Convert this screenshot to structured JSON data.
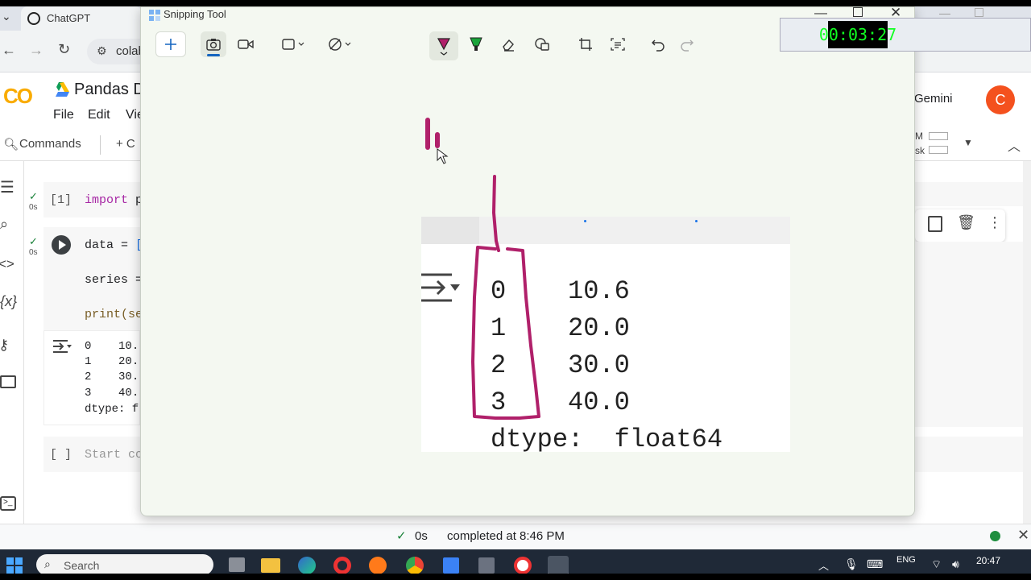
{
  "browser": {
    "tab_title": "ChatGPT",
    "url_partial": "colab"
  },
  "colab": {
    "logo": "CO",
    "title_partial": "Pandas D",
    "menu": [
      "File",
      "Edit",
      "Vie"
    ],
    "gemini_label": "Gemini",
    "avatar_letter": "C",
    "commands_label": "Commands",
    "add_code_partial": "+ C",
    "ram_label": "M",
    "disk_label": "sk",
    "cell1": {
      "prompt": "[1]",
      "exec_time": "0s",
      "keyword": "import",
      "rest": " p"
    },
    "cell2": {
      "exec_time": "0s",
      "lines": [
        {
          "text": "data = ",
          "bracket": "["
        },
        {
          "text": "series =",
          "bracket": ""
        },
        {
          "text": "print(se",
          "bracket": ""
        }
      ]
    },
    "output_rows": [
      {
        "idx": "0",
        "val": "10."
      },
      {
        "idx": "1",
        "val": "20."
      },
      {
        "idx": "2",
        "val": "30."
      },
      {
        "idx": "3",
        "val": "40."
      }
    ],
    "output_dtype": "dtype: f",
    "cell3": {
      "prompt": "[ ]",
      "placeholder": "Start co"
    },
    "status": {
      "time": "0s",
      "completed": "completed at 8:46 PM"
    }
  },
  "snipping_tool": {
    "title": "Snipping Tool",
    "zoom_output": {
      "rows": [
        {
          "idx": "0",
          "val": "10.6"
        },
        {
          "idx": "1",
          "val": "20.0"
        },
        {
          "idx": "2",
          "val": "30.0"
        },
        {
          "idx": "3",
          "val": "40.0"
        }
      ],
      "dtype": "dtype:  float64"
    },
    "pen_color": "#b0206a",
    "highlighter_color": "#1aa33a"
  },
  "recorder": {
    "time": "00:03:27"
  },
  "taskbar": {
    "search_placeholder": "Search",
    "lang": "ENG",
    "clock": "20:47"
  },
  "colors": {
    "colab_orange": "#f9ab00",
    "avatar_bg": "#f4511e",
    "record_red": "#d92b1c",
    "keyword_purple": "#a626a4"
  }
}
